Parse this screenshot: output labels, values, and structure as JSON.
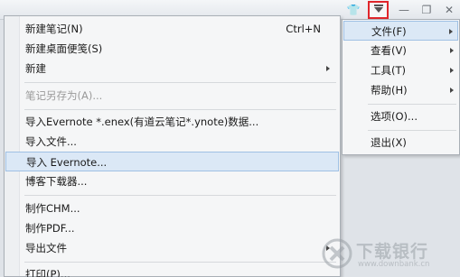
{
  "main_menu": {
    "items": [
      {
        "label": "新建笔记(N)",
        "shortcut": "Ctrl+N",
        "submenu": false,
        "disabled": false
      },
      {
        "label": "新建桌面便笺(S)",
        "shortcut": "",
        "submenu": false,
        "disabled": false
      },
      {
        "label": "新建",
        "shortcut": "",
        "submenu": true,
        "disabled": false
      },
      {
        "label": "笔记另存为(A)...",
        "shortcut": "",
        "submenu": false,
        "disabled": true
      },
      {
        "label": "导入Evernote *.enex(有道云笔记*.ynote)数据...",
        "shortcut": "",
        "submenu": false,
        "disabled": false
      },
      {
        "label": "导入文件...",
        "shortcut": "",
        "submenu": false,
        "disabled": false
      },
      {
        "label": "导入 Evernote...",
        "shortcut": "",
        "submenu": false,
        "disabled": false,
        "selected": true
      },
      {
        "label": "博客下载器...",
        "shortcut": "",
        "submenu": false,
        "disabled": false
      },
      {
        "label": "制作CHM...",
        "shortcut": "",
        "submenu": false,
        "disabled": false
      },
      {
        "label": "制作PDF...",
        "shortcut": "",
        "submenu": false,
        "disabled": false
      },
      {
        "label": "导出文件",
        "shortcut": "",
        "submenu": true,
        "disabled": false
      },
      {
        "label": "打印(P)...",
        "shortcut": "",
        "submenu": false,
        "disabled": false
      }
    ]
  },
  "right_menu": {
    "items": [
      {
        "label": "文件(F)",
        "submenu": true,
        "selected": true
      },
      {
        "label": "查看(V)",
        "submenu": true
      },
      {
        "label": "工具(T)",
        "submenu": true
      },
      {
        "label": "帮助(H)",
        "submenu": true
      },
      {
        "label": "选项(O)...",
        "submenu": false
      },
      {
        "label": "退出(X)",
        "submenu": false
      }
    ]
  },
  "watermark": {
    "text": "下载银行",
    "url": "www.downbank.cn"
  },
  "colors": {
    "highlight": "#dbe8f6",
    "highlight_border": "#9fc0e4",
    "menu_bg": "#f5f6f7",
    "menu_button_outline": "#e0262b"
  }
}
